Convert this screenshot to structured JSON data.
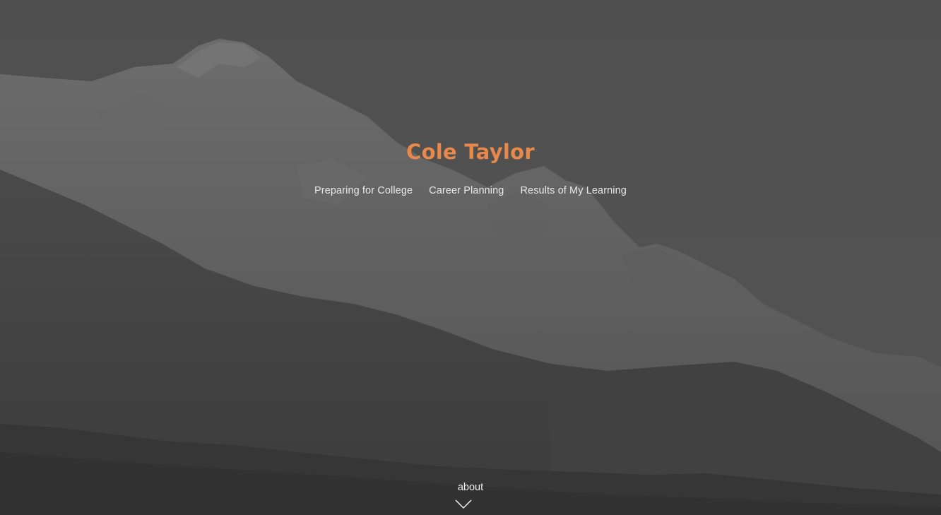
{
  "header": {
    "title": "Cole Taylor"
  },
  "nav": {
    "items": [
      {
        "label": "Preparing for College"
      },
      {
        "label": "Career Planning"
      },
      {
        "label": "Results of My Learning"
      }
    ]
  },
  "scroll_hint": {
    "label": "about",
    "icon": "chevron-down-icon"
  },
  "colors": {
    "accent": "#e8884a",
    "nav_text": "#e8e8e8",
    "overlay": "#4a4a4a"
  }
}
